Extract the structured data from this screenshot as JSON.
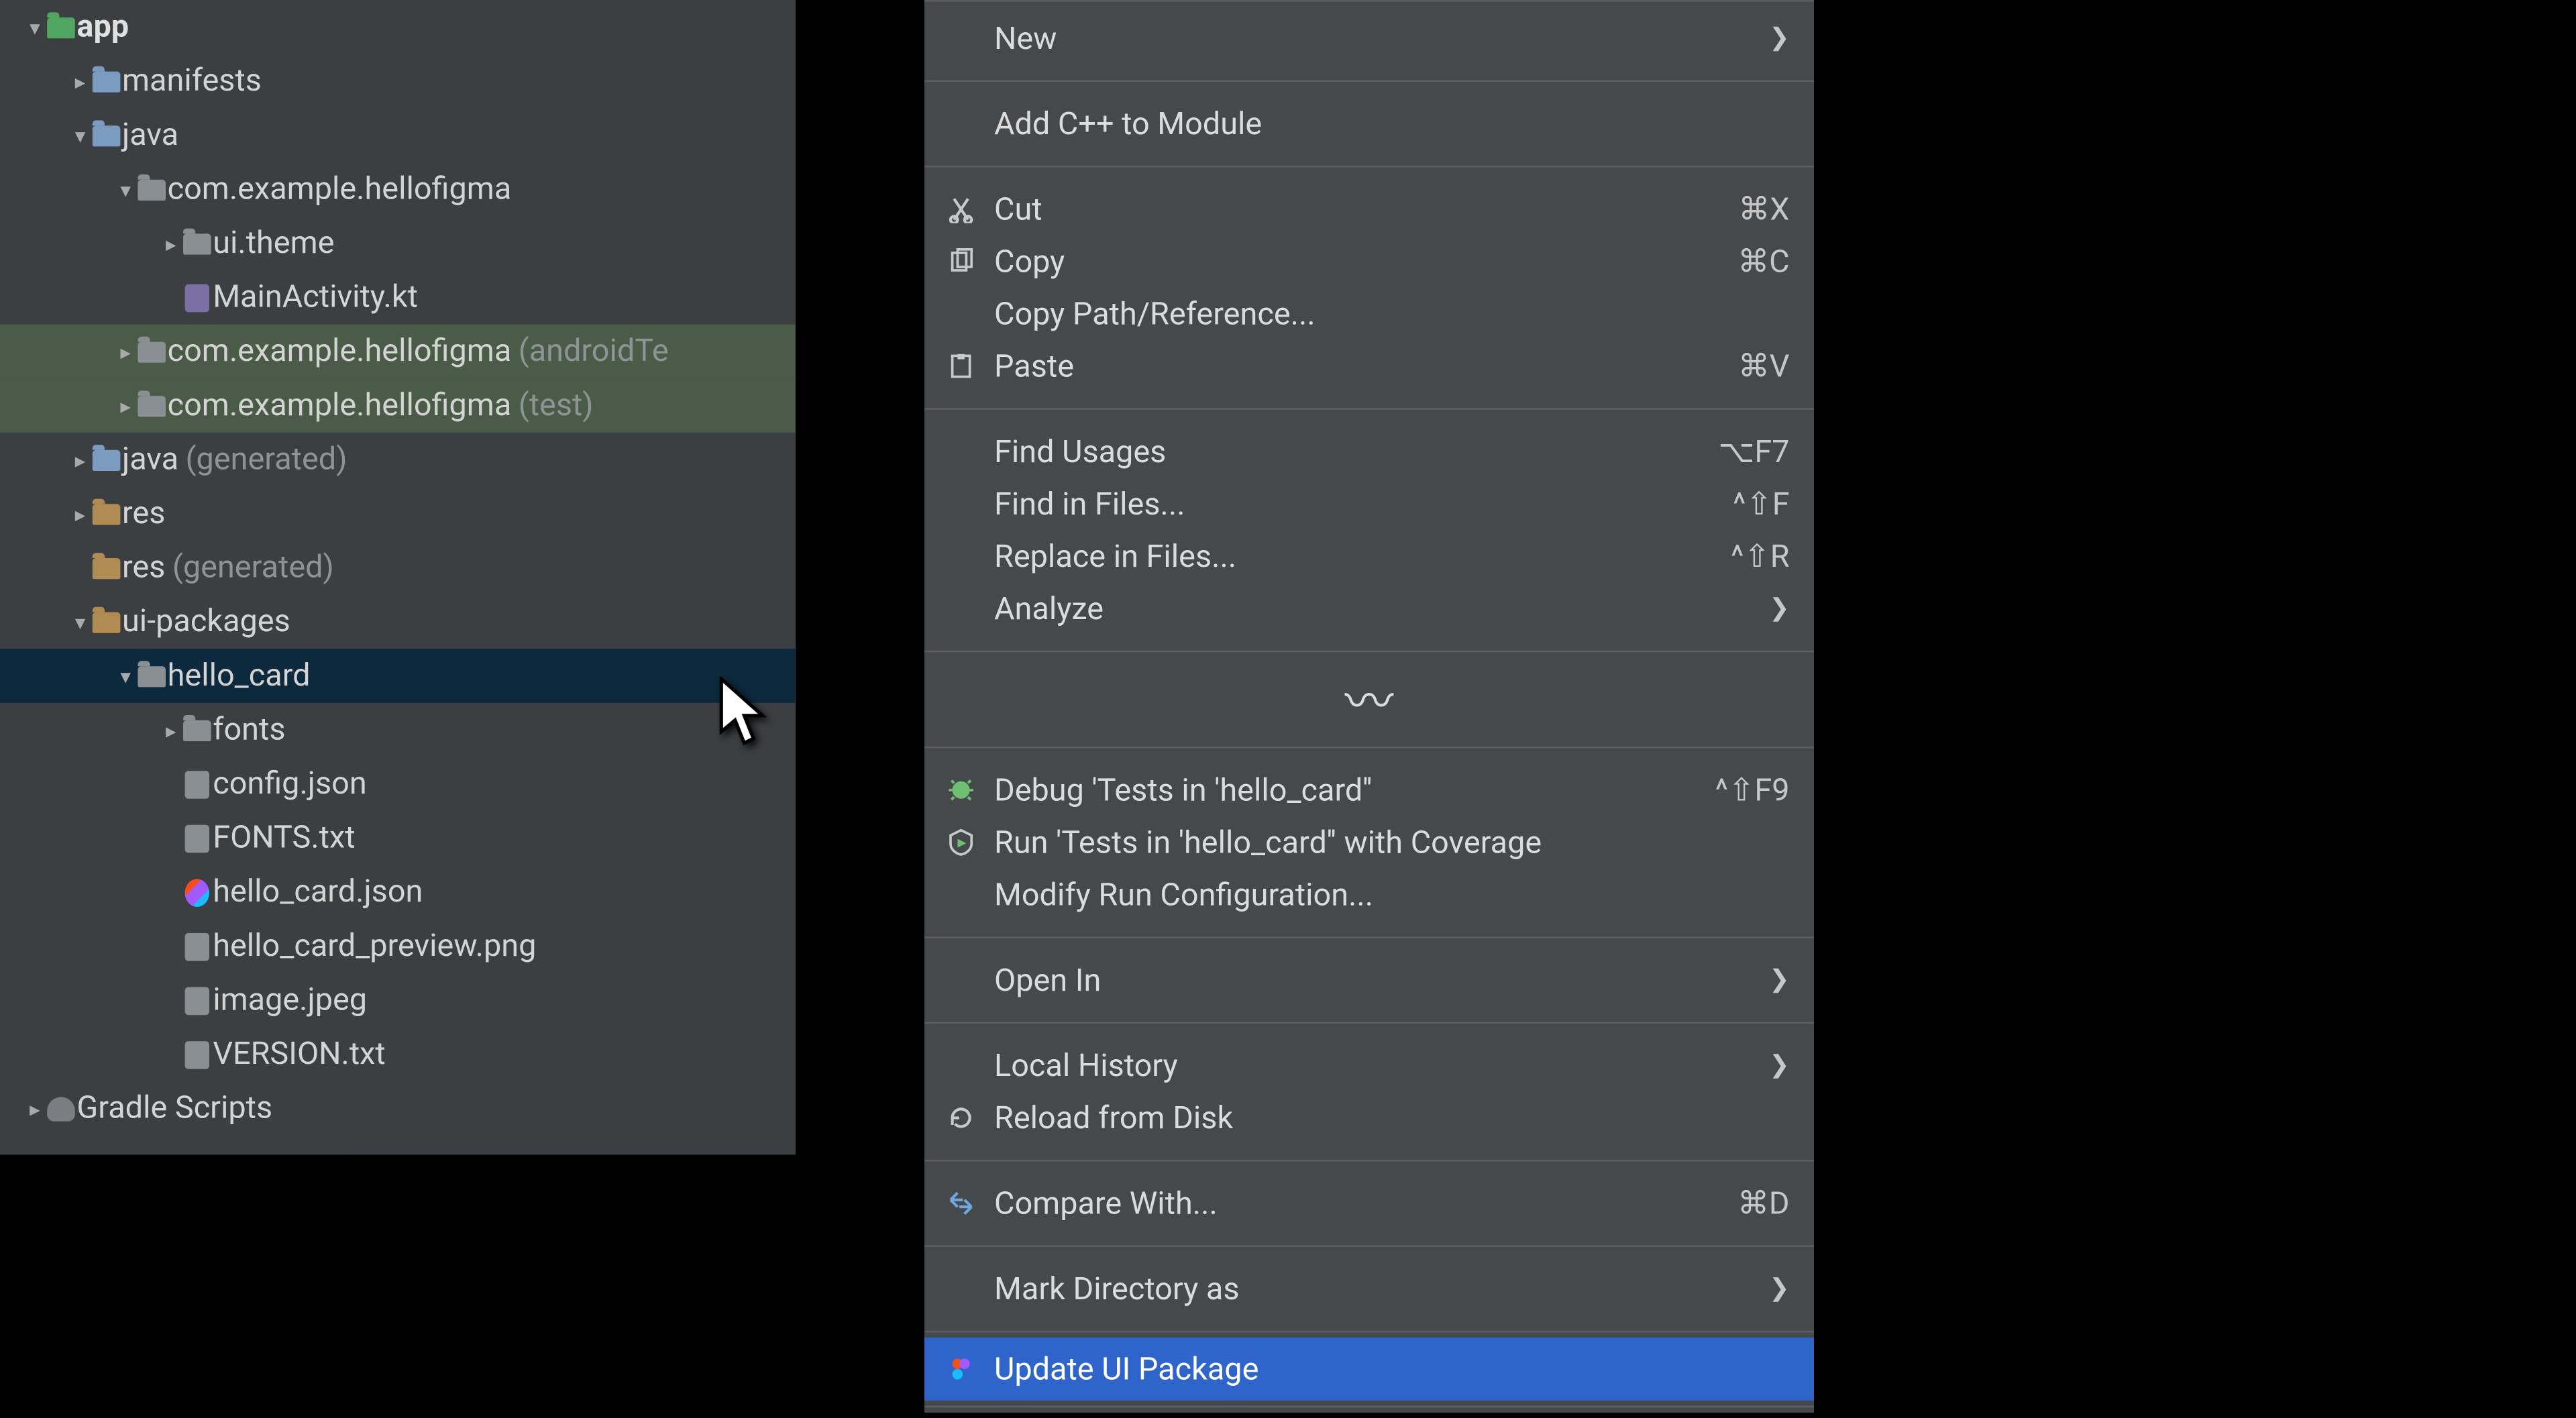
{
  "tree": {
    "app": "app",
    "manifests": "manifests",
    "java": "java",
    "pkg_main": "com.example.hellofigma",
    "ui_theme": "ui.theme",
    "main_activity": "MainActivity.kt",
    "pkg_androidTest": "com.example.hellofigma",
    "pkg_androidTest_suffix": "(androidTe",
    "pkg_test": "com.example.hellofigma",
    "pkg_test_suffix": "(test)",
    "java_gen": "java",
    "java_gen_suffix": "(generated)",
    "res": "res",
    "res_gen": "res",
    "res_gen_suffix": "(generated)",
    "ui_packages": "ui-packages",
    "hello_card": "hello_card",
    "fonts": "fonts",
    "config_json": "config.json",
    "fonts_txt": "FONTS.txt",
    "hello_card_json": "hello_card.json",
    "hello_card_preview": "hello_card_preview.png",
    "image_jpeg": "image.jpeg",
    "version_txt": "VERSION.txt",
    "gradle_scripts": "Gradle Scripts"
  },
  "menu": {
    "new": "New",
    "add_cpp": "Add C++ to Module",
    "cut": "Cut",
    "cut_sc": "⌘X",
    "copy": "Copy",
    "copy_sc": "⌘C",
    "copy_path": "Copy Path/Reference...",
    "paste": "Paste",
    "paste_sc": "⌘V",
    "find_usages": "Find Usages",
    "find_usages_sc": "⌥F7",
    "find_in_files": "Find in Files...",
    "find_in_files_sc": "^⇧F",
    "replace_in_files": "Replace in Files...",
    "replace_in_files_sc": "^⇧R",
    "analyze": "Analyze",
    "debug_tests": "Debug 'Tests in 'hello_card''",
    "debug_tests_sc": "^⇧F9",
    "run_coverage": "Run 'Tests in 'hello_card'' with Coverage",
    "modify_run": "Modify Run Configuration...",
    "open_in": "Open In",
    "local_history": "Local History",
    "reload_disk": "Reload from Disk",
    "compare_with": "Compare With...",
    "compare_with_sc": "⌘D",
    "mark_dir": "Mark Directory as",
    "update_ui_pkg": "Update UI Package"
  }
}
